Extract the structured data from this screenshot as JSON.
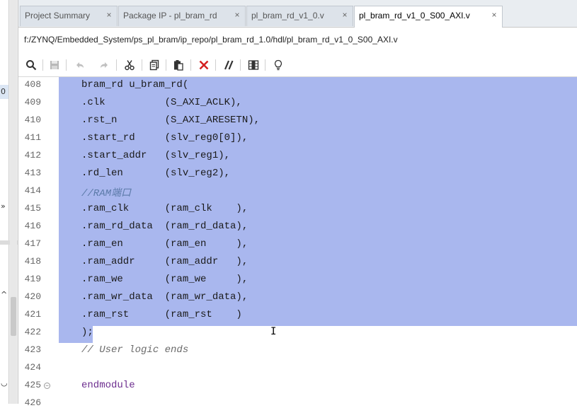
{
  "tabs": [
    {
      "label": "Project Summary",
      "active": false
    },
    {
      "label": "Package IP - pl_bram_rd",
      "active": false
    },
    {
      "label": "pl_bram_rd_v1_0.v",
      "active": false
    },
    {
      "label": "pl_bram_rd_v1_0_S00_AXI.v",
      "active": true
    }
  ],
  "close_glyph": "×",
  "file_path": "f:/ZYNQ/Embedded_System/ps_pl_bram/ip_repo/pl_bram_rd_1.0/hdl/pl_bram_rd_v1_0_S00_AXI.v",
  "left_strip": {
    "glyph_a": "0",
    "glyph_b": "»",
    "glyph_c": "^",
    "glyph_d": "◡"
  },
  "toolbar": [
    {
      "icon": "search-icon"
    },
    {
      "icon": "save-icon"
    },
    {
      "icon": "undo-icon"
    },
    {
      "icon": "redo-icon"
    },
    {
      "icon": "cut-icon"
    },
    {
      "icon": "copy-icon"
    },
    {
      "icon": "paste-icon"
    },
    {
      "icon": "delete-icon"
    },
    {
      "icon": "comment-toggle-icon"
    },
    {
      "icon": "column-select-icon"
    },
    {
      "icon": "lightbulb-icon"
    }
  ],
  "code": [
    {
      "n": "408",
      "text": "bram_rd u_bram_rd(",
      "kind": "code"
    },
    {
      "n": "409",
      "text": ".clk          (S_AXI_ACLK),",
      "kind": "code"
    },
    {
      "n": "410",
      "text": ".rst_n        (S_AXI_ARESETN),",
      "kind": "code"
    },
    {
      "n": "411",
      "text": ".start_rd     (slv_reg0[0]),",
      "kind": "code"
    },
    {
      "n": "412",
      "text": ".start_addr   (slv_reg1),",
      "kind": "code"
    },
    {
      "n": "413",
      "text": ".rd_len       (slv_reg2),",
      "kind": "code"
    },
    {
      "n": "414",
      "text": "//RAM端口",
      "kind": "comment-blue"
    },
    {
      "n": "415",
      "text": ".ram_clk      (ram_clk    ),",
      "kind": "code"
    },
    {
      "n": "416",
      "text": ".ram_rd_data  (ram_rd_data),",
      "kind": "code"
    },
    {
      "n": "417",
      "text": ".ram_en       (ram_en     ),",
      "kind": "code"
    },
    {
      "n": "418",
      "text": ".ram_addr     (ram_addr   ),",
      "kind": "code"
    },
    {
      "n": "419",
      "text": ".ram_we       (ram_we     ),",
      "kind": "code"
    },
    {
      "n": "420",
      "text": ".ram_wr_data  (ram_wr_data),",
      "kind": "code"
    },
    {
      "n": "421",
      "text": ".ram_rst      (ram_rst    )",
      "kind": "code"
    },
    {
      "n": "422",
      "text": ");",
      "kind": "code"
    },
    {
      "n": "423",
      "text": "// User logic ends",
      "kind": "comment"
    },
    {
      "n": "424",
      "text": "",
      "kind": "code"
    },
    {
      "n": "425",
      "text": "endmodule",
      "kind": "kw"
    },
    {
      "n": "426",
      "text": "",
      "kind": "code"
    }
  ],
  "fold_glyph": "−",
  "cursor_glyph": "I",
  "colors": {
    "selection": "#a9b7ee",
    "keyword": "#6d2e8f",
    "comment": "#6b6b6b"
  }
}
